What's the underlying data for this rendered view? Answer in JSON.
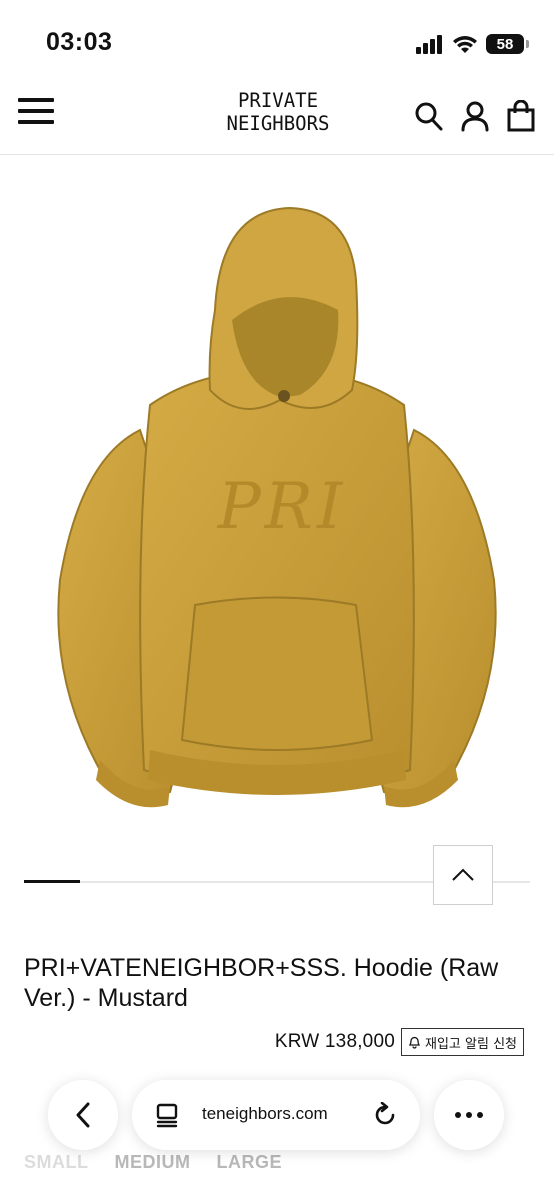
{
  "status_bar": {
    "time": "03:03",
    "battery": "58",
    "icons": [
      "signal-icon",
      "wifi-icon",
      "battery-icon"
    ]
  },
  "header": {
    "logo_line1": "PRIVATE",
    "logo_line2": "NEIGHBORS",
    "icons": [
      "menu-icon",
      "search-icon",
      "account-icon",
      "bag-icon"
    ]
  },
  "product": {
    "image_alt": "Mustard hoodie",
    "image_label": "PRI",
    "title": "PRI+VATENEIGHBOR+SSS. Hoodie (Raw Ver.) - Mustard",
    "price": "KRW 138,000",
    "restock_label": "재입고 알림 신청",
    "gallery_position": 0.1,
    "sizes": [
      {
        "label": "SMALL",
        "available": false
      },
      {
        "label": "MEDIUM",
        "available": true
      },
      {
        "label": "LARGE",
        "available": true
      }
    ]
  },
  "browser": {
    "url": "teneighbors.com",
    "icons": [
      "back-icon",
      "tabs-icon",
      "reload-icon",
      "more-icon"
    ]
  },
  "colors": {
    "hoodie": "#C9A03C",
    "hoodie_shadow": "#A88326",
    "text": "#111111",
    "border": "#cfcfcf"
  }
}
